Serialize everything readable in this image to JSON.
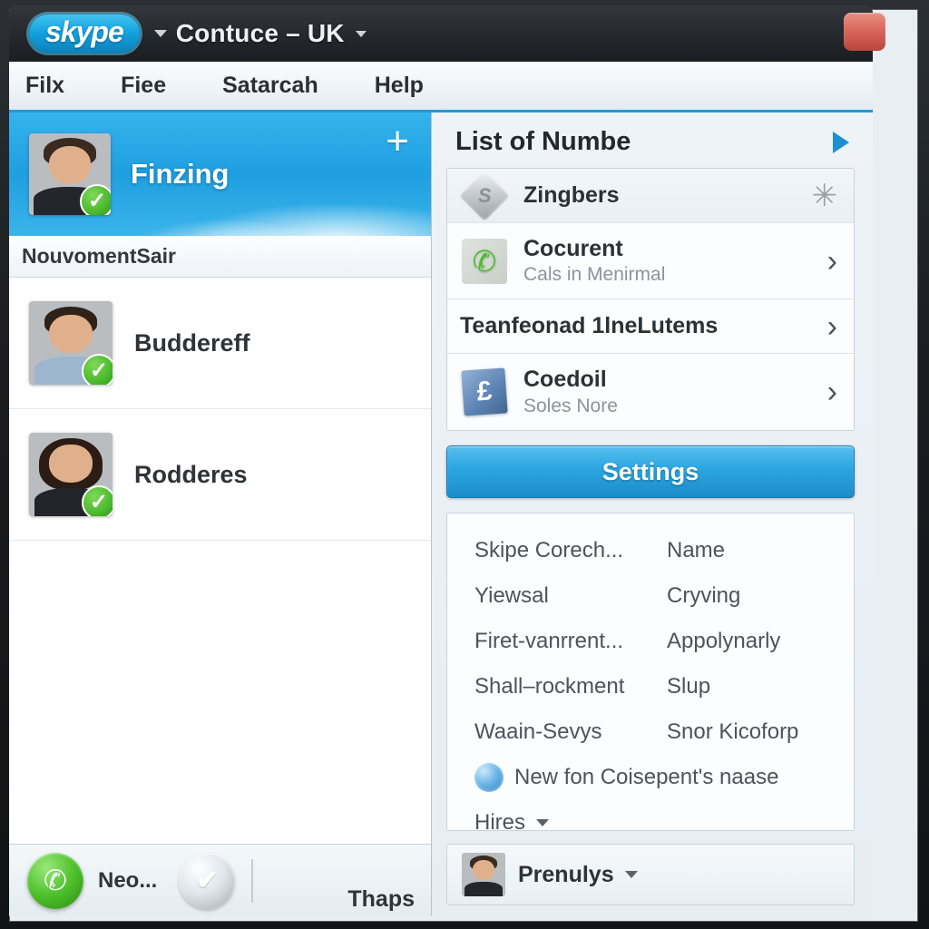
{
  "titlebar": {
    "logo_text": "skype",
    "profile_caret": "caret-down-icon",
    "title": "Contuce – UK",
    "title_caret": "caret-down-icon",
    "close_label": "close-button"
  },
  "menubar": {
    "items": [
      {
        "label": "Filx"
      },
      {
        "label": "Fiee"
      },
      {
        "label": "Satarcah"
      },
      {
        "label": "Help"
      }
    ]
  },
  "sidebar": {
    "profile": {
      "name": "Finzing",
      "presence": "✓",
      "add_label": "+"
    },
    "group_header": "NouvomentSair",
    "contacts": [
      {
        "name": "Buddereff",
        "presence": "✓"
      },
      {
        "name": "Rodderes",
        "presence": "✓"
      }
    ],
    "statusbar": {
      "call_icon": "✆",
      "status_text": "Neo...",
      "check_icon": "✔",
      "right_label": "Thaps"
    }
  },
  "right_panel": {
    "title": "List of Numbe",
    "expand_icon": "triangle-right-icon",
    "nav_items": [
      {
        "icon": "diamond-s-icon",
        "icon_glyph": "S",
        "label": "Zingbers",
        "sub": "",
        "trailing": "✳"
      },
      {
        "icon": "green-phone-icon",
        "icon_glyph": "✆",
        "label": "Cocurent",
        "sub": "Cals in Menirmal",
        "trailing": "›"
      },
      {
        "icon": "",
        "icon_glyph": "",
        "label": "Teanfeonad 1lneLutems",
        "sub": "",
        "trailing": "›"
      },
      {
        "icon": "pound-voucher-icon",
        "icon_glyph": "£",
        "label": "Coedoil",
        "sub": "Soles Nore",
        "trailing": "›"
      }
    ],
    "settings_button": "Settings",
    "info_rows": [
      {
        "col_a": "Skipe Corech...",
        "col_b": "Name"
      },
      {
        "col_a": "Yiewsal",
        "col_b": "Cryving"
      },
      {
        "col_a": "Firet-vanrrent...",
        "col_b": "Appolynarly"
      },
      {
        "col_a": "Shall–rockment",
        "col_b": "Slup"
      },
      {
        "col_a": "Waain-Sevys",
        "col_b": "Snor Kicoforp"
      }
    ],
    "promo_row": {
      "icon": "globe-icon",
      "label": "New fon Coisepent's naase"
    },
    "dropdown_row": {
      "label": "Hires",
      "caret": "caret-down-icon"
    },
    "statusbar": {
      "label": "Prenulys",
      "caret": "caret-down-icon"
    }
  },
  "colors": {
    "accent_blue": "#2ca7e2",
    "header_blue": "#1f9fe0",
    "online_green": "#49b82c",
    "close_red": "#d9685c"
  }
}
